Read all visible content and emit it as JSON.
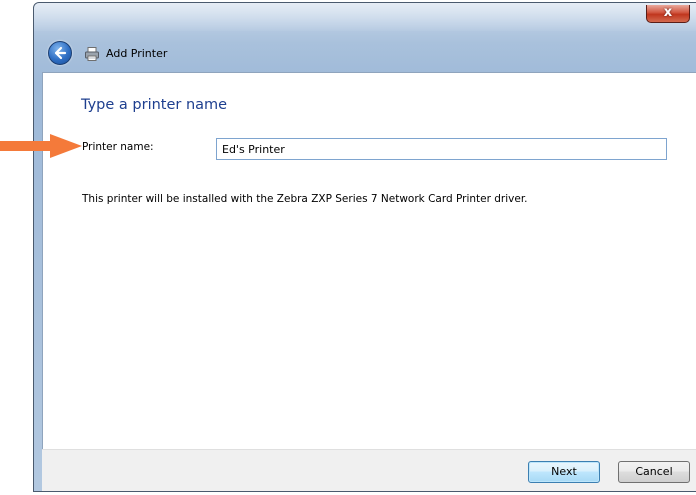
{
  "window": {
    "title": "Add Printer",
    "close_label": "x"
  },
  "wizard": {
    "heading": "Type a printer name",
    "printer_name_label": "Printer name:",
    "printer_name_value": "Ed's Printer",
    "info_text": "This printer will be installed with the Zebra ZXP Series 7 Network Card Printer driver."
  },
  "buttons": {
    "next_label": "Next",
    "cancel_label": "Cancel"
  },
  "colors": {
    "heading": "#1e3f8f",
    "callout_arrow": "#f47a3a",
    "input_border": "#7ea4cf"
  },
  "icons": {
    "back": "back-arrow-icon",
    "printer": "printer-icon",
    "close": "close-icon",
    "callout": "callout-arrow-icon"
  }
}
